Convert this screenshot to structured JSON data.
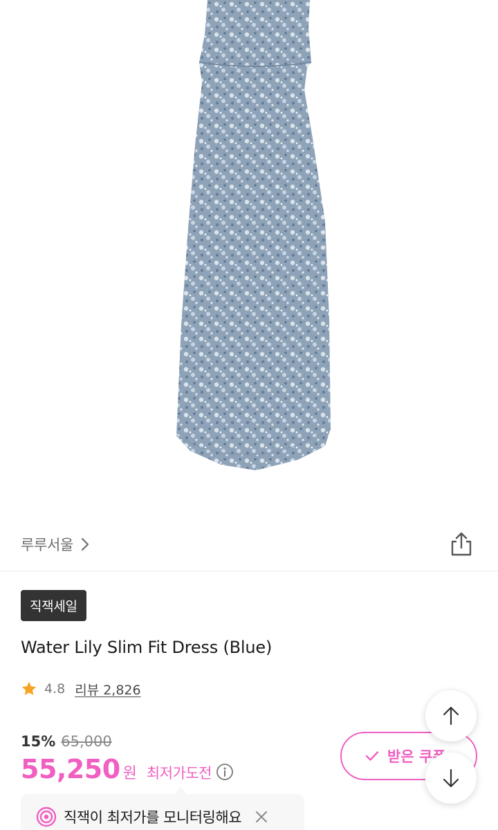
{
  "brand": {
    "name": "루루서울"
  },
  "badge": {
    "label": "직잭세일"
  },
  "product": {
    "title": "Water Lily Slim Fit Dress (Blue)",
    "rating": "4.8",
    "review_link": "리뷰 2,826"
  },
  "price": {
    "discount_rate": "15%",
    "original": "65,000",
    "sale": "55,250",
    "currency": "원",
    "lowest_label": "최저가도전"
  },
  "coupon": {
    "label": "받은 쿠폰"
  },
  "monitor": {
    "text": "직잭이 최저가를 모니터링해요"
  },
  "icons": {
    "share": "share-icon",
    "chevron": "chevron-right-icon",
    "star": "star-icon",
    "info": "info-icon",
    "check": "check-icon",
    "arrow_up": "arrow-up-icon",
    "arrow_down": "arrow-down-icon",
    "target": "target-icon",
    "close": "close-icon"
  },
  "colors": {
    "accent": "#f05fc1",
    "badge_bg": "#333333",
    "star": "#f7a325",
    "dress": "#8fa7bd"
  }
}
